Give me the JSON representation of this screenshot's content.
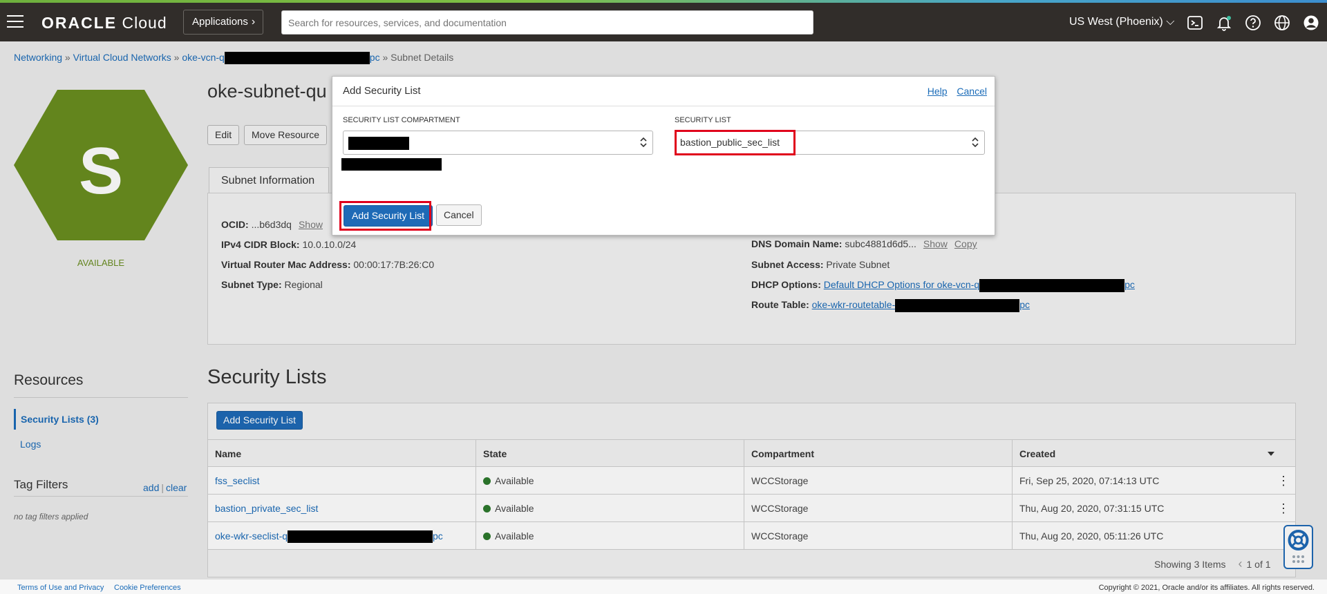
{
  "header": {
    "brand_main": "ORACLE",
    "brand_sub": "Cloud",
    "apps_label": "Applications",
    "search_placeholder": "Search for resources, services, and documentation",
    "region": "US West (Phoenix)"
  },
  "breadcrumb": {
    "networking": "Networking",
    "vcns": "Virtual Cloud Networks",
    "vcn_prefix": "oke-vcn-q",
    "vcn_suffix": "pc",
    "current": "Subnet Details"
  },
  "colors": {
    "accent": "#1e6ab6",
    "hex_green": "#6a8e1f",
    "highlight": "#e0001b",
    "header_bg": "#312d2a"
  },
  "subnet": {
    "letter": "S",
    "status": "AVAILABLE",
    "title": "oke-subnet-qu",
    "edit_label": "Edit",
    "move_label": "Move Resource",
    "tab_label": "Subnet Information",
    "ocid_label": "OCID:",
    "ocid_value": "...b6d3dq",
    "show_label": "Show",
    "copy_label": "Copy",
    "cidr_label": "IPv4 CIDR Block:",
    "cidr_value": "10.0.10.0/24",
    "mac_label": "Virtual Router Mac Address:",
    "mac_value": "00:00:17:7B:26:C0",
    "type_label": "Subnet Type:",
    "type_value": "Regional",
    "dns_label": "DNS Domain Name:",
    "dns_value": "subc4881d6d5...",
    "access_label": "Subnet Access:",
    "access_value": "Private Subnet",
    "dhcp_label": "DHCP Options:",
    "dhcp_prefix": "Default DHCP Options for oke-vcn-q",
    "dhcp_suffix": "pc",
    "route_label": "Route Table:",
    "route_prefix": "oke-wkr-routetable-",
    "route_suffix": "pc"
  },
  "resources": {
    "title": "Resources",
    "items": [
      "Security Lists (3)",
      "Logs"
    ],
    "tag_title": "Tag Filters",
    "tag_add": "add",
    "tag_clear": "clear",
    "tag_empty": "no tag filters applied"
  },
  "security_lists": {
    "title": "Security Lists",
    "add_label": "Add Security List",
    "columns": [
      "Name",
      "State",
      "Compartment",
      "Created"
    ],
    "rows": [
      {
        "name": "fss_seclist",
        "state": "Available",
        "compartment": "WCCStorage",
        "created": "Fri, Sep 25, 2020, 07:14:13 UTC"
      },
      {
        "name": "bastion_private_sec_list",
        "state": "Available",
        "compartment": "WCCStorage",
        "created": "Thu, Aug 20, 2020, 07:31:15 UTC"
      },
      {
        "name": "oke-wkr-seclist-q",
        "name_suffix": "pc",
        "state": "Available",
        "compartment": "WCCStorage",
        "created": "Thu, Aug 20, 2020, 05:11:26 UTC"
      }
    ],
    "showing": "Showing 3 Items",
    "page": "1 of 1"
  },
  "modal": {
    "title": "Add Security List",
    "help": "Help",
    "cancel_link": "Cancel",
    "compartment_label": "SECURITY LIST COMPARTMENT",
    "list_label": "SECURITY LIST",
    "list_value": "bastion_public_sec_list",
    "submit_label": "Add Security List",
    "cancel_label": "Cancel"
  },
  "footer": {
    "terms": "Terms of Use and Privacy",
    "cookies": "Cookie Preferences",
    "copyright": "Copyright © 2021, Oracle and/or its affiliates. All rights reserved."
  }
}
